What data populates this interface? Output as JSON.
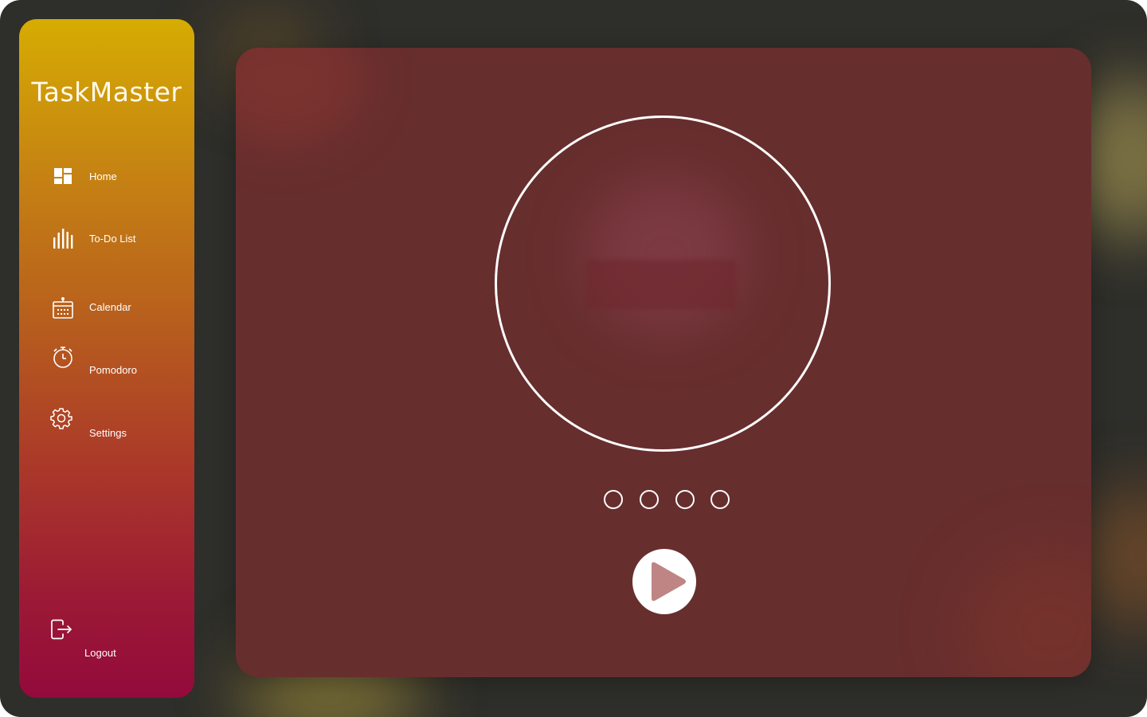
{
  "app": {
    "name": "TaskMaster"
  },
  "sidebar": {
    "items": [
      {
        "label": "Home",
        "icon": "dashboard-icon"
      },
      {
        "label": "To-Do List",
        "icon": "bars-icon"
      },
      {
        "label": "Calendar",
        "icon": "calendar-icon"
      },
      {
        "label": "Pomodoro",
        "icon": "timer-icon"
      },
      {
        "label": "Settings",
        "icon": "gear-icon"
      }
    ],
    "logout": {
      "label": "Logout",
      "icon": "logout-icon"
    }
  },
  "pomodoro": {
    "session_dots": 4,
    "completed_sessions": 0,
    "play_icon": "play-icon"
  },
  "colors": {
    "sidebar_top": "#d6ac02",
    "sidebar_bottom": "#930a3c",
    "panel": "#672e2e",
    "background": "#2e2e2a",
    "play_triangle": "#bf8585"
  }
}
